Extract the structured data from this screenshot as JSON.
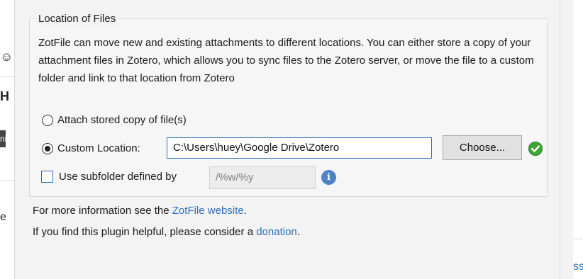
{
  "background": {
    "left_glyphs": [
      "☺",
      "H",
      "ni",
      "e"
    ],
    "right_snippet": "ssi"
  },
  "group": {
    "legend": "Location of Files",
    "description": "ZotFile can move new and existing attachments to different locations. You can either store a copy of your attachment files in Zotero, which allows you to sync files to the Zotero server, or move the file to a custom folder and link to that location from Zotero"
  },
  "options": {
    "attach_label": "Attach stored copy of file(s)",
    "attach_selected": false,
    "custom_label": "Custom Location:",
    "custom_selected": true,
    "custom_path": "C:\\Users\\huey\\Google Drive\\Zotero",
    "choose_label": "Choose...",
    "status_icon": "check-icon",
    "subfolder_label": "Use subfolder defined by",
    "subfolder_checked": false,
    "subfolder_pattern": "/%w/%y",
    "info_icon": "i"
  },
  "footer": {
    "line1_prefix": "For more information see the ",
    "line1_link": "ZotFile website",
    "line1_suffix": ".",
    "line2_prefix": "If you find this plugin helpful, please consider a ",
    "line2_link": "donation",
    "line2_suffix": "."
  },
  "colors": {
    "accent": "#2a6fc0",
    "ok_green": "#3fa535",
    "info_blue": "#4d83c6"
  }
}
